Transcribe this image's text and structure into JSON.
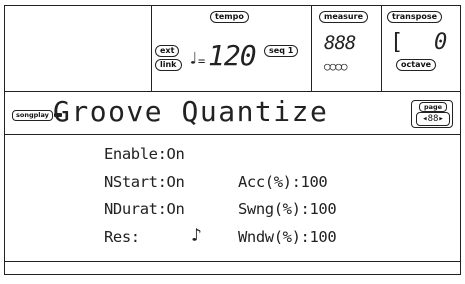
{
  "header": {
    "tempo": {
      "label": "tempo",
      "ext_label": "ext",
      "link_label": "link",
      "note_symbol": "♩",
      "equals": "=",
      "value": "120",
      "seq_label": "seq 1"
    },
    "measure": {
      "label": "measure",
      "value": "888",
      "beats": "○○○○"
    },
    "transpose": {
      "label": "transpose",
      "bracket": "[",
      "value": "0",
      "octave_label": "octave"
    }
  },
  "title_bar": {
    "mode_icon": "songplay",
    "title": "Groove Quantize",
    "page_label": "page",
    "page_value": "◂88▸"
  },
  "params": {
    "enable": "Enable:On",
    "nstart": "NStart:On",
    "ndurat": "NDurat:On",
    "res_label": "Res:",
    "res_value": "♪",
    "acc": "Acc(%):100",
    "swng": "Swng(%):100",
    "wndw": "Wndw(%):100"
  }
}
